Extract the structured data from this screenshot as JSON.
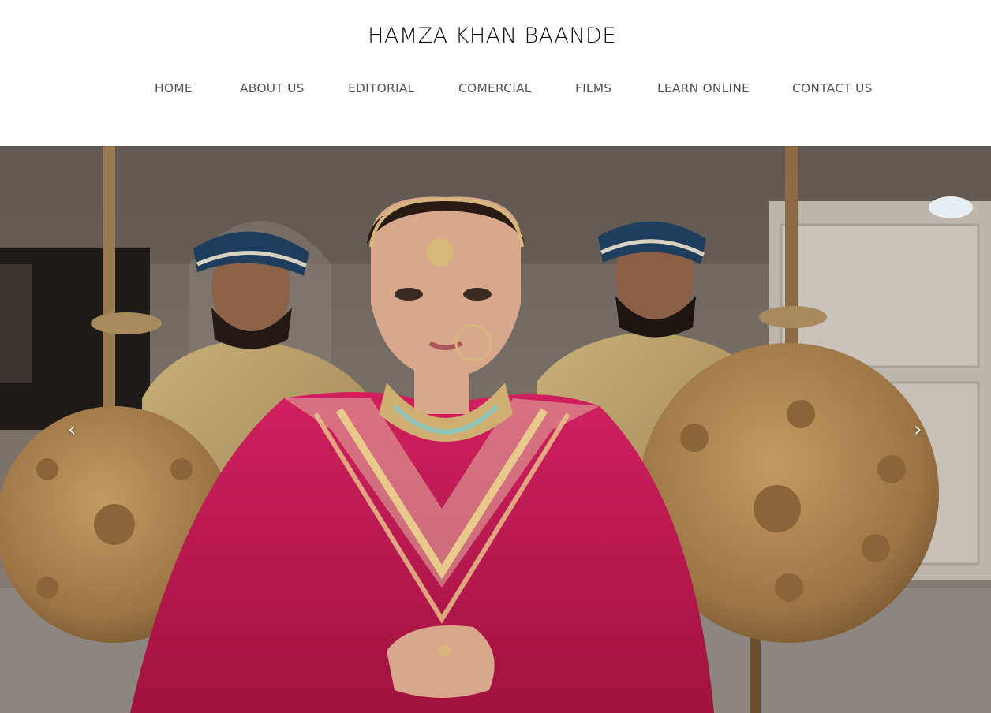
{
  "site": {
    "title": "HAMZA KHAN BAANDE"
  },
  "nav": {
    "items": [
      {
        "label": "HOME"
      },
      {
        "label": "ABOUT US"
      },
      {
        "label": "EDITORIAL"
      },
      {
        "label": "COMERCIAL"
      },
      {
        "label": "FILMS"
      },
      {
        "label": "LEARN ONLINE"
      },
      {
        "label": "CONTACT US"
      }
    ]
  },
  "slider": {
    "prev_icon": "chevron-left-icon",
    "next_icon": "chevron-right-icon",
    "prev_glyph": "‹",
    "next_glyph": "›"
  },
  "colors": {
    "dress": "#c01a54",
    "gold": "#b28a4a",
    "turban": "#1f3d5c",
    "wall": "#7a716a"
  }
}
